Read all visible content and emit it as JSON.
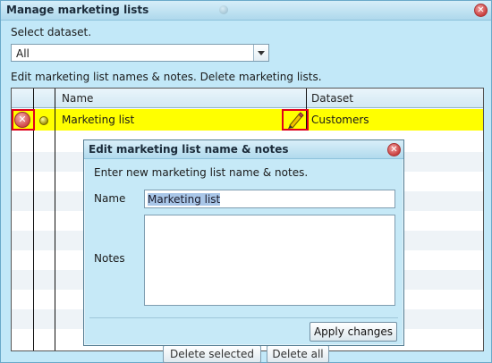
{
  "window": {
    "title": "Manage marketing lists",
    "select_dataset_label": "Select dataset.",
    "dataset_select_value": "All",
    "edit_instructions": "Edit marketing list names & notes. Delete marketing lists."
  },
  "table": {
    "columns": [
      "Name",
      "Dataset"
    ],
    "rows": [
      {
        "name": "Marketing list",
        "dataset": "Customers",
        "selected": true
      }
    ]
  },
  "footer": {
    "delete_selected_label": "Delete selected",
    "delete_all_label": "Delete all"
  },
  "modal": {
    "title": "Edit marketing list name & notes",
    "instruction": "Enter new marketing list name & notes.",
    "name_label": "Name",
    "name_value": "Marketing list",
    "notes_label": "Notes",
    "notes_value": "",
    "apply_label": "Apply changes"
  },
  "colors": {
    "dialog_bg": "#c2e8f8",
    "selected_row": "#ffff00",
    "highlight_box": "#e0001b"
  },
  "icons": [
    "close-icon",
    "delete-icon",
    "status-dot-icon",
    "pencil-icon",
    "chevron-down-icon"
  ]
}
